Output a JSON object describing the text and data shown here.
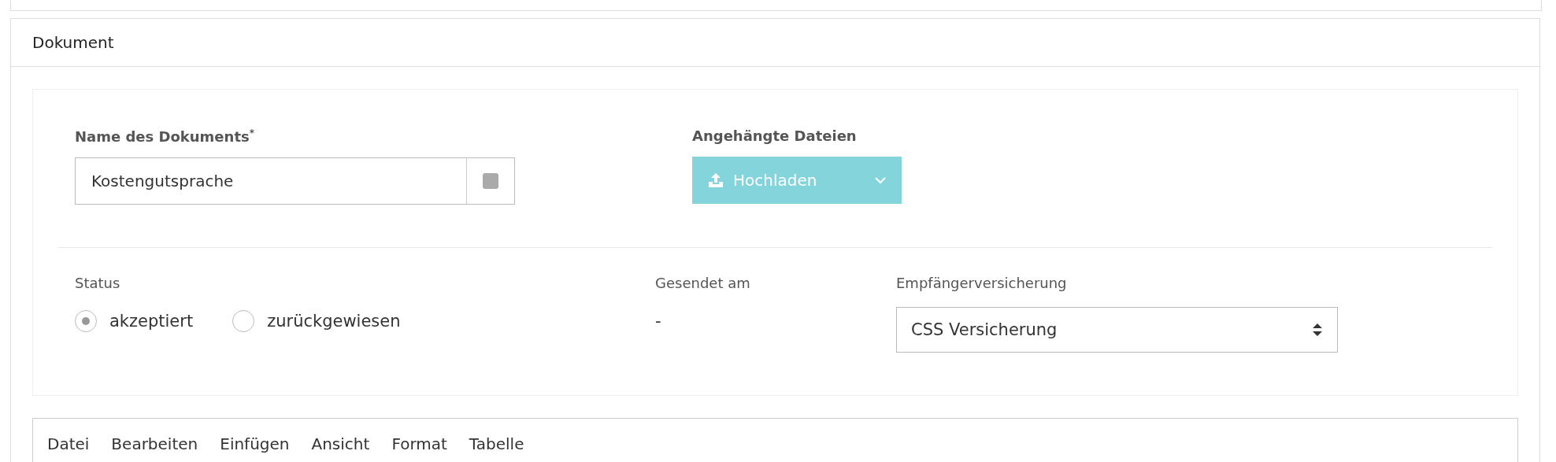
{
  "panel": {
    "title": "Dokument"
  },
  "name_field": {
    "label": "Name des Dokuments",
    "required_mark": "*",
    "value": "Kostengutsprache"
  },
  "attachments": {
    "label": "Angehängte Dateien",
    "button": "Hochladen"
  },
  "status": {
    "label": "Status",
    "options": [
      {
        "label": "akzeptiert",
        "selected": true
      },
      {
        "label": "zurückgewiesen",
        "selected": false
      }
    ]
  },
  "sent": {
    "label": "Gesendet am",
    "value": "-"
  },
  "insurance": {
    "label": "Empfängerversicherung",
    "value": "CSS Versicherung"
  },
  "editor_menu": [
    "Datei",
    "Bearbeiten",
    "Einfügen",
    "Ansicht",
    "Format",
    "Tabelle"
  ]
}
